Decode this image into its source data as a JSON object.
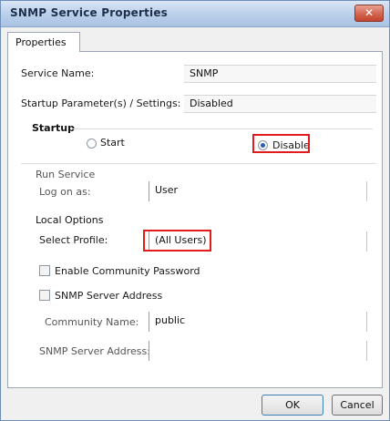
{
  "window": {
    "title": "SNMP Service Properties",
    "close_glyph": "✕"
  },
  "tabs": [
    {
      "label": "Properties"
    }
  ],
  "fields": {
    "row1_label": "Service Name:",
    "row1_value": "SNMP",
    "row2_label": "Startup Parameter(s) / Settings:",
    "row2_value": "Disabled"
  },
  "startup": {
    "label": "Startup",
    "option1": "Start",
    "option2": "Disable"
  },
  "group1": {
    "label": "Run Service",
    "field_label": "Log on as:",
    "field_value": "User"
  },
  "group2": {
    "label": "Local Options",
    "select_label": "Select Profile:",
    "select_value": "(All Users)",
    "checkbox1": "Enable Community Password",
    "checkbox2": "SNMP Server Address",
    "sub_label1": "Community Name:",
    "sub_value1": "public",
    "sub_label2": "SNMP Server Address:",
    "sub_value2": ""
  },
  "buttons": {
    "ok": "OK",
    "cancel": "Cancel"
  }
}
